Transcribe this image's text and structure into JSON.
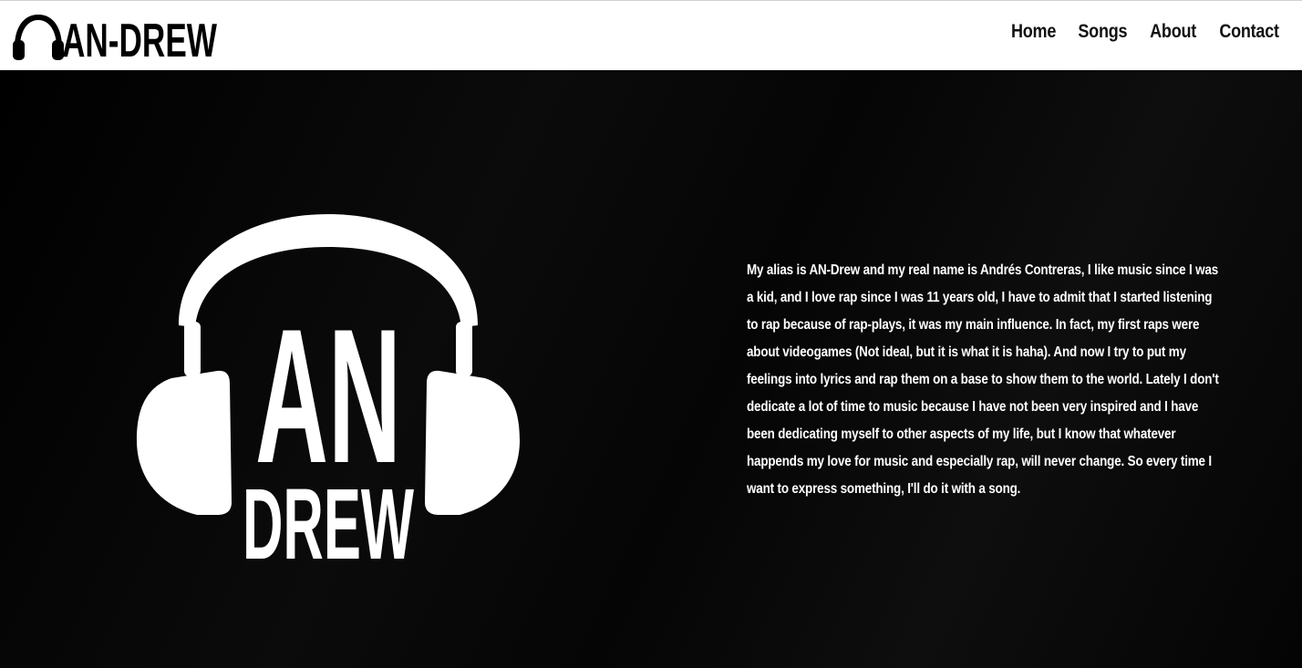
{
  "header": {
    "logo_text": "AN-DREW",
    "logo_icon": "headphones-icon",
    "background": "#ffffff",
    "nav": [
      {
        "label": "Home"
      },
      {
        "label": "Songs"
      },
      {
        "label": "About"
      },
      {
        "label": "Contact"
      }
    ]
  },
  "hero": {
    "background": "#000000",
    "logo_icon": "headphones-logo-icon",
    "logo_text_top": "AN",
    "logo_text_bottom": "DREW",
    "bio": "My alias is AN-Drew and my real name is Andrés Contreras, I like music since I was a kid, and I love rap since I was 11 years old, I have to admit that I started listening to rap because of rap-plays, it was my main influence. In fact, my first raps were about videogames (Not ideal, but it is what it is haha). And now I try to put my feelings into lyrics and rap them on a base to show them to the world. Lately I don't dedicate a lot of time to music because I have not been very inspired and I have been dedicating myself to other aspects of my life, but I know that whatever happends my love for music and especially rap, will never change. So every time I want to express something, I'll do it with a song."
  }
}
